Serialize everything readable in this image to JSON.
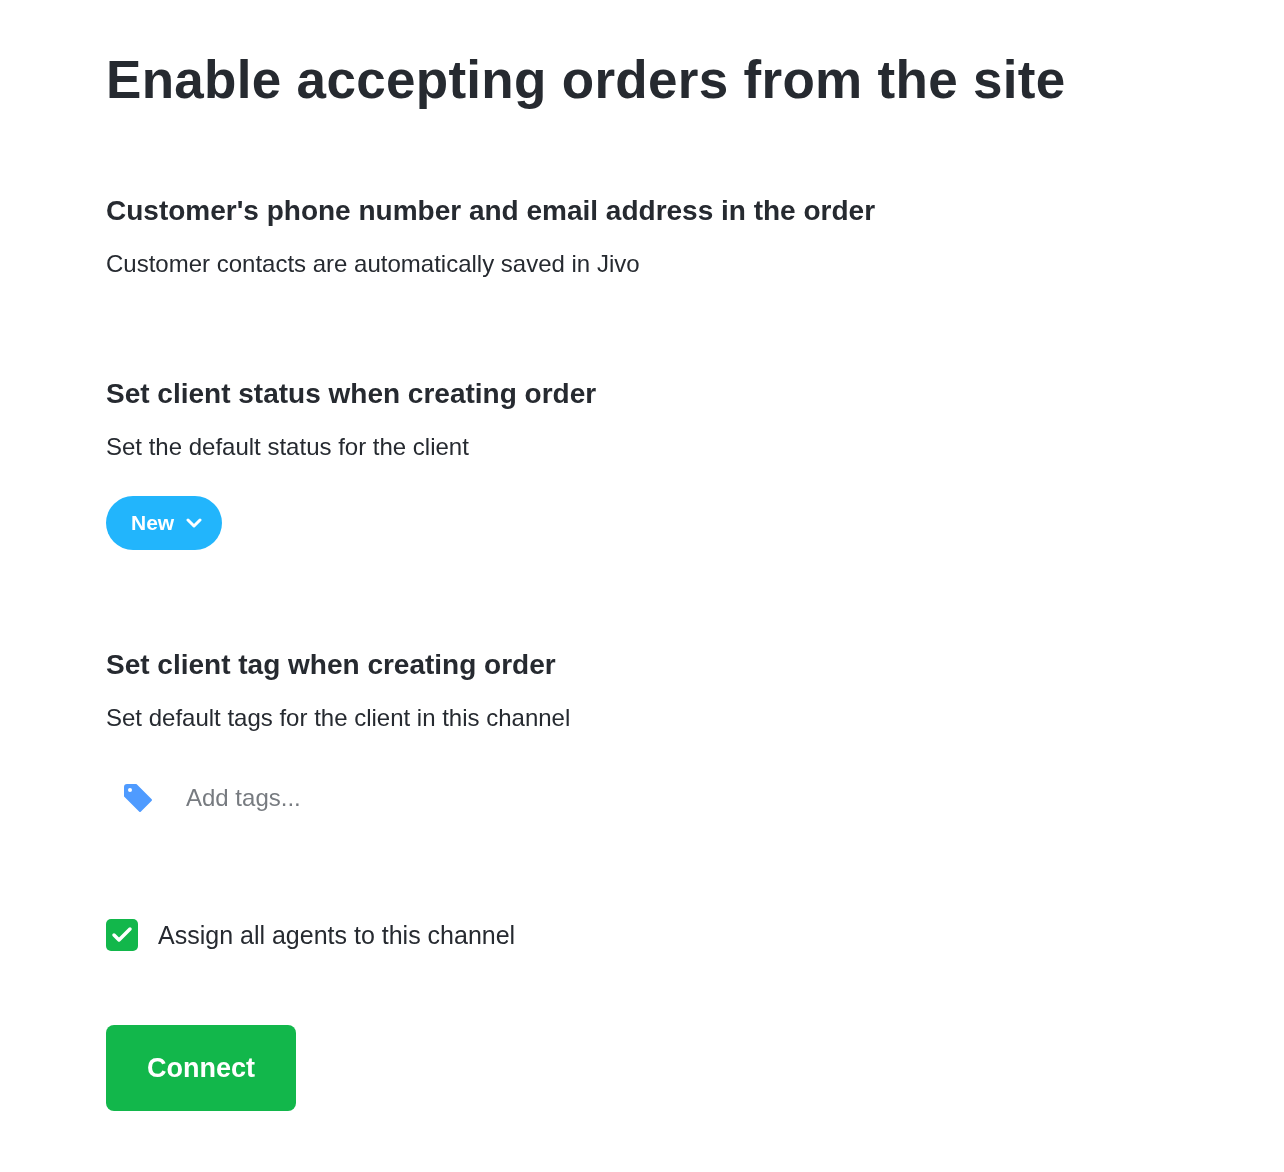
{
  "title": "Enable accepting orders from the site",
  "sections": [
    {
      "kind": "info",
      "heading": "Customer's phone number and email address in the order",
      "description": "Customer contacts are automatically saved in Jivo"
    },
    {
      "kind": "status",
      "heading": "Set client status when creating order",
      "description": "Set the default status for the client",
      "status": {
        "label": "New",
        "color": "#22b5fc"
      }
    },
    {
      "kind": "tags",
      "heading": "Set client tag when creating order",
      "description": "Set default tags for the client in this channel",
      "tags": {
        "placeholder": "Add tags..."
      }
    }
  ],
  "assign_all_agents": {
    "label": "Assign all agents to this channel",
    "checked": true
  },
  "connect_button": {
    "label": "Connect"
  }
}
